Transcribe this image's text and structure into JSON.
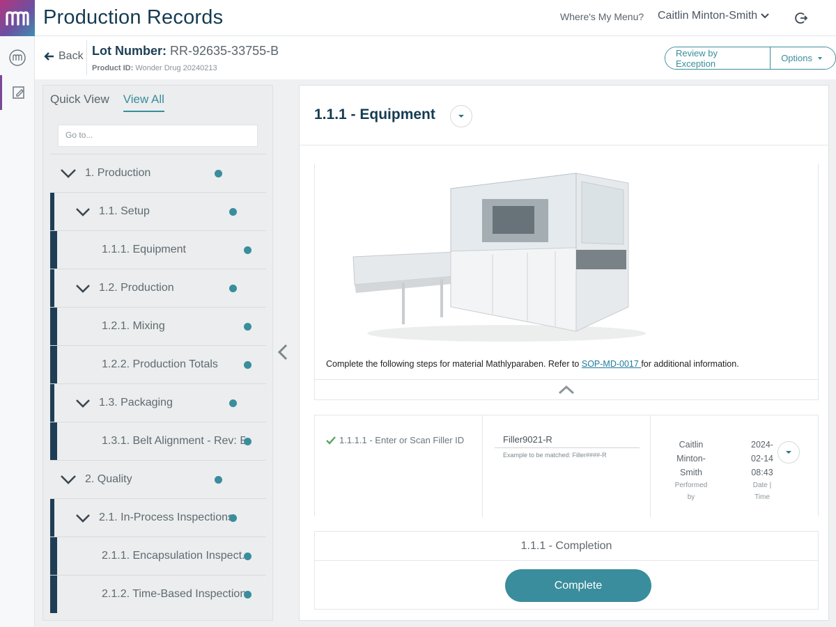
{
  "header": {
    "app_title": "Production Records",
    "wheres_menu": "Where's My Menu?",
    "user_name": "Caitlin Minton-Smith"
  },
  "subheader": {
    "back_label": "Back",
    "lot_label": "Lot Number:",
    "lot_value": "RR-92635-33755-B",
    "product_label": "Product ID:",
    "product_value": "Wonder Drug 20240213",
    "review_button": "Review by Exception",
    "options_button": "Options"
  },
  "nav": {
    "tabs": [
      {
        "label": "Quick View",
        "active": false
      },
      {
        "label": "View All",
        "active": true
      }
    ],
    "goto_placeholder": "Go to...",
    "tree": [
      {
        "label": "1.  Production",
        "level": 0,
        "expanded": true
      },
      {
        "label": "1.1.  Setup",
        "level": 1,
        "expanded": true
      },
      {
        "label": "1.1.1.  Equipment",
        "level": 2
      },
      {
        "label": "1.2.  Production",
        "level": 1,
        "expanded": true
      },
      {
        "label": "1.2.1.  Mixing",
        "level": 2
      },
      {
        "label": "1.2.2.  Production Totals",
        "level": 2
      },
      {
        "label": "1.3.  Packaging",
        "level": 1,
        "expanded": true
      },
      {
        "label": "1.3.1.  Belt Alignment - Rev: B",
        "level": 2
      },
      {
        "label": "2.  Quality",
        "level": 0,
        "expanded": true
      },
      {
        "label": "2.1.  In-Process Inspections",
        "level": 1,
        "expanded": true
      },
      {
        "label": "2.1.1.  Encapsulation Inspect...",
        "level": 2
      },
      {
        "label": "2.1.2.  Time-Based Inspection",
        "level": 2
      }
    ]
  },
  "main": {
    "title": "1.1.1 - Equipment",
    "instruction_prefix": "Complete the following steps for material Mathlyparaben. Refer to ",
    "instruction_link": "SOP-MD-0017 ",
    "instruction_suffix": "for additional information.",
    "step": {
      "label": "1.1.1.1 - Enter or Scan Filler ID",
      "value": "Filler9021-R",
      "hint": "Example to be matched: Filler####-R",
      "performer": "Caitlin Minton-Smith",
      "performer_lines": [
        "Caitlin",
        "Minton-",
        "Smith"
      ],
      "performer_caption_lines": [
        "Performed",
        "by"
      ],
      "date_lines": [
        "2024-",
        "02-14",
        "08:43"
      ],
      "date_caption_lines": [
        "Date |",
        "Time"
      ]
    },
    "completion_title": "1.1.1 - Completion",
    "complete_button": "Complete"
  },
  "colors": {
    "accent": "#3a8d9c",
    "navy": "#153b52",
    "tree_bar": "#1f3e55"
  }
}
